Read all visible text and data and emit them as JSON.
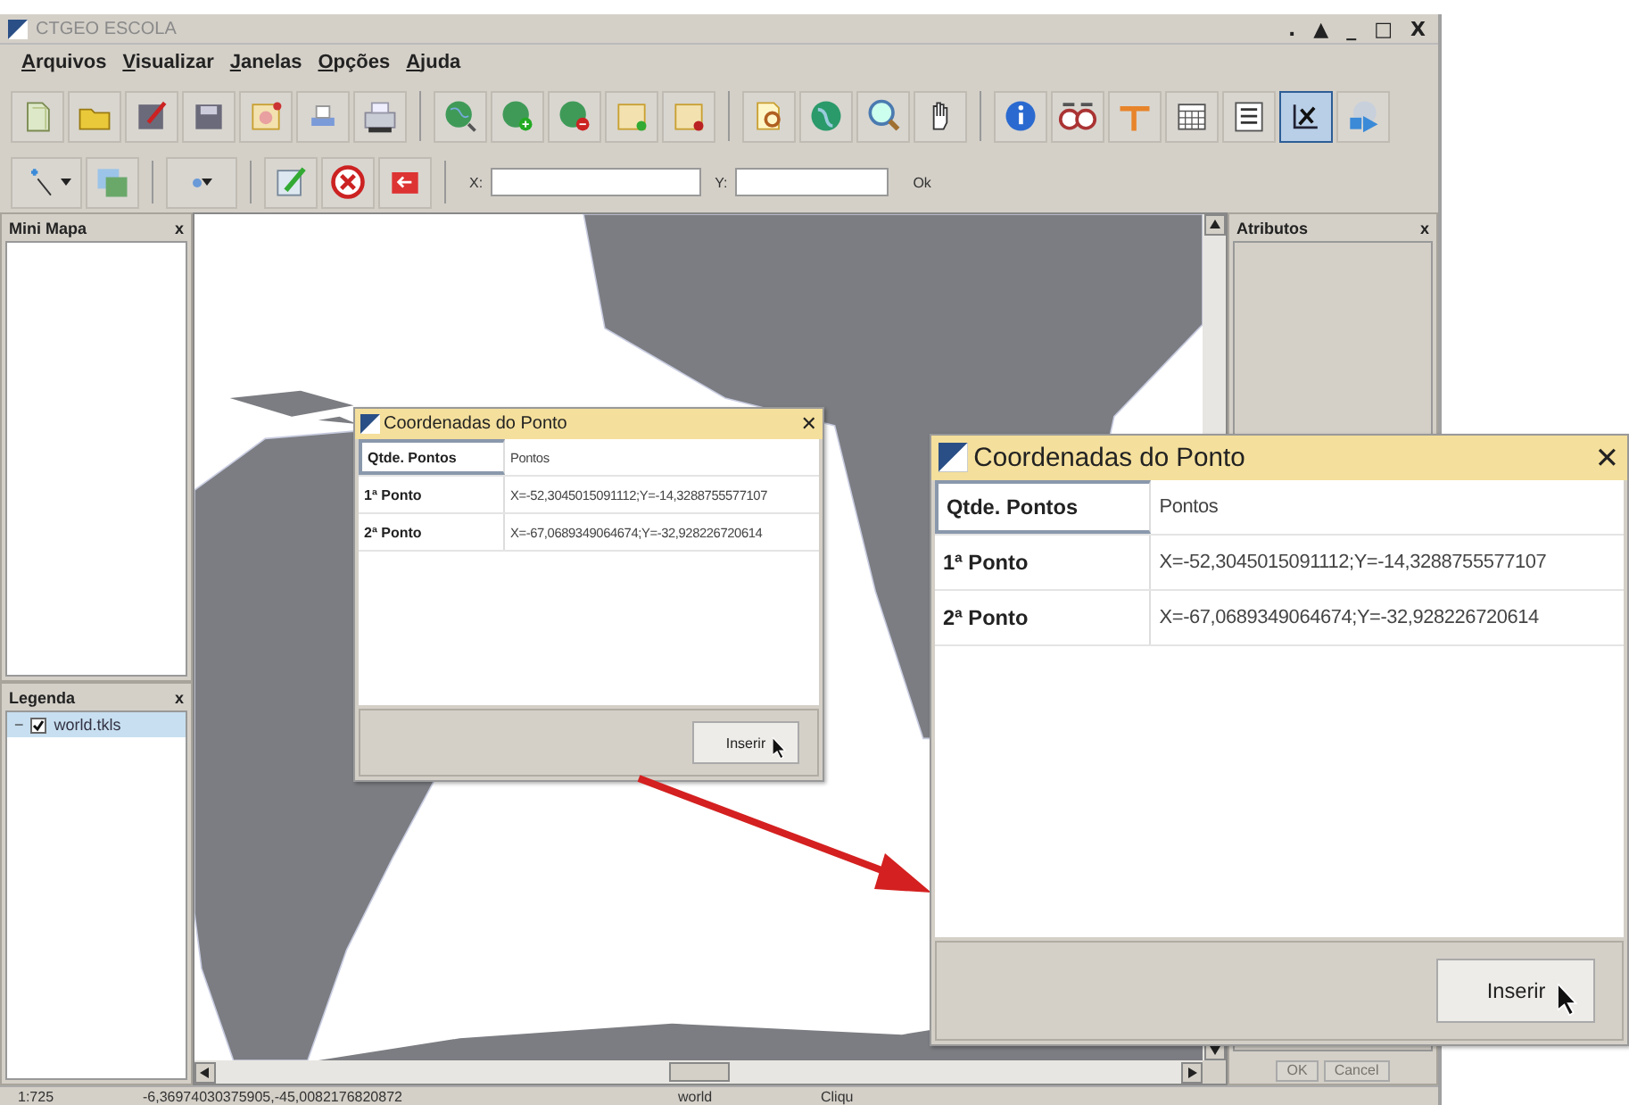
{
  "window": {
    "title": "CTGEO ESCOLA",
    "controls": [
      ".",
      "▲",
      "_",
      "□",
      "X"
    ]
  },
  "menu": [
    "Arquivos",
    "Visualizar",
    "Janelas",
    "Opções",
    "Ajuda"
  ],
  "coordinate_tool": {
    "selected": true
  },
  "coordinates_bar": {
    "x_label": "X:",
    "y_label": "Y:",
    "ok": "Ok"
  },
  "mini_map": {
    "title": "Mini Mapa",
    "close": "x"
  },
  "legend": {
    "title": "Legenda",
    "close": "x",
    "layers": [
      {
        "toggle": "−",
        "name": "world.tkls",
        "checked": true,
        "selected": true
      }
    ]
  },
  "attributes": {
    "title": "Atributos",
    "close": "x",
    "buttons": [
      {
        "label": "OK",
        "disabled": true
      },
      {
        "label": "Cancel",
        "disabled": true
      }
    ]
  },
  "point_dialog": {
    "title": "Coordenadas do Ponto",
    "close": "✕",
    "header": [
      "Qtde. Pontos",
      "Pontos"
    ],
    "rows": [
      {
        "label": "1ª Ponto",
        "value": "X=-52,3045015091112;Y=-14,3288755577107"
      },
      {
        "label": "2ª Ponto",
        "value": "X=-67,0689349064674;Y=-32,928226720614"
      }
    ],
    "button": "Inserir"
  },
  "point_dialog_zoomed": {
    "title": "Coordenadas do Ponto",
    "close": "✕",
    "header": [
      "Qtde. Pontos",
      "Pontos"
    ],
    "rows": [
      {
        "label": "1ª Ponto",
        "value": "X=-52,3045015091112;Y=-14,3288755577107"
      },
      {
        "label": "2ª Ponto",
        "value": "X=-67,0689349064674;Y=-32,928226720614"
      }
    ],
    "button": "Inserir"
  },
  "status_bar": [
    "1:725",
    "-6,36974030375905,-45,0082176820872",
    "world",
    "Cliqu"
  ]
}
